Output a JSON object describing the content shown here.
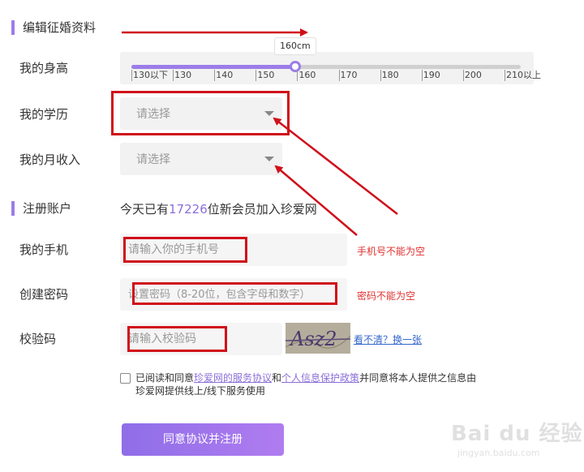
{
  "sections": {
    "profile_title": "编辑征婚资料",
    "account_title": "注册账户"
  },
  "height_row": {
    "label": "我的身高",
    "value_label": "160cm",
    "value": 160,
    "range": [
      130,
      210
    ],
    "ticks": [
      {
        "value": 130,
        "label": "130以下"
      },
      {
        "value": 140,
        "label": "130"
      },
      {
        "value": 150,
        "label": "140"
      },
      {
        "value": 160,
        "label": "150"
      },
      {
        "value": 170,
        "label": "160"
      },
      {
        "value": 180,
        "label": "170"
      },
      {
        "value": 190,
        "label": "180"
      },
      {
        "value": 200,
        "label": "190"
      },
      {
        "value": 210,
        "label": "200"
      },
      {
        "value": 220,
        "label": "210以上"
      }
    ]
  },
  "education_row": {
    "label": "我的学历",
    "placeholder": "请选择"
  },
  "income_row": {
    "label": "我的月收入",
    "placeholder": "请选择"
  },
  "member_info": {
    "prefix": "今天已有",
    "count": "17226",
    "suffix": "位新会员加入珍爱网"
  },
  "phone_row": {
    "label": "我的手机",
    "placeholder": "请输入你的手机号",
    "error": "手机号不能为空"
  },
  "password_row": {
    "label": "创建密码",
    "placeholder": "设置密码（8-20位，包含字母和数字）",
    "error": "密码不能为空"
  },
  "captcha_row": {
    "label": "校验码",
    "placeholder": "请输入校验码",
    "captcha_text": "Asz2",
    "refresh_link": "看不清？换一张"
  },
  "agreement": {
    "part1": "已阅读和同意",
    "link1": "珍爱网的服务协议",
    "part2": "和",
    "link2": "个人信息保护政策",
    "part3": "并同意将本人提供之信息由珍爱网提供线上/线下服务使用"
  },
  "submit_label": "同意协议并注册",
  "watermark": {
    "main": "Bai du 经验",
    "sub": "jingyan.baidu.com"
  },
  "colors": {
    "accent": "#9b7de8",
    "annotation": "#d0101a",
    "error": "#e03030"
  }
}
